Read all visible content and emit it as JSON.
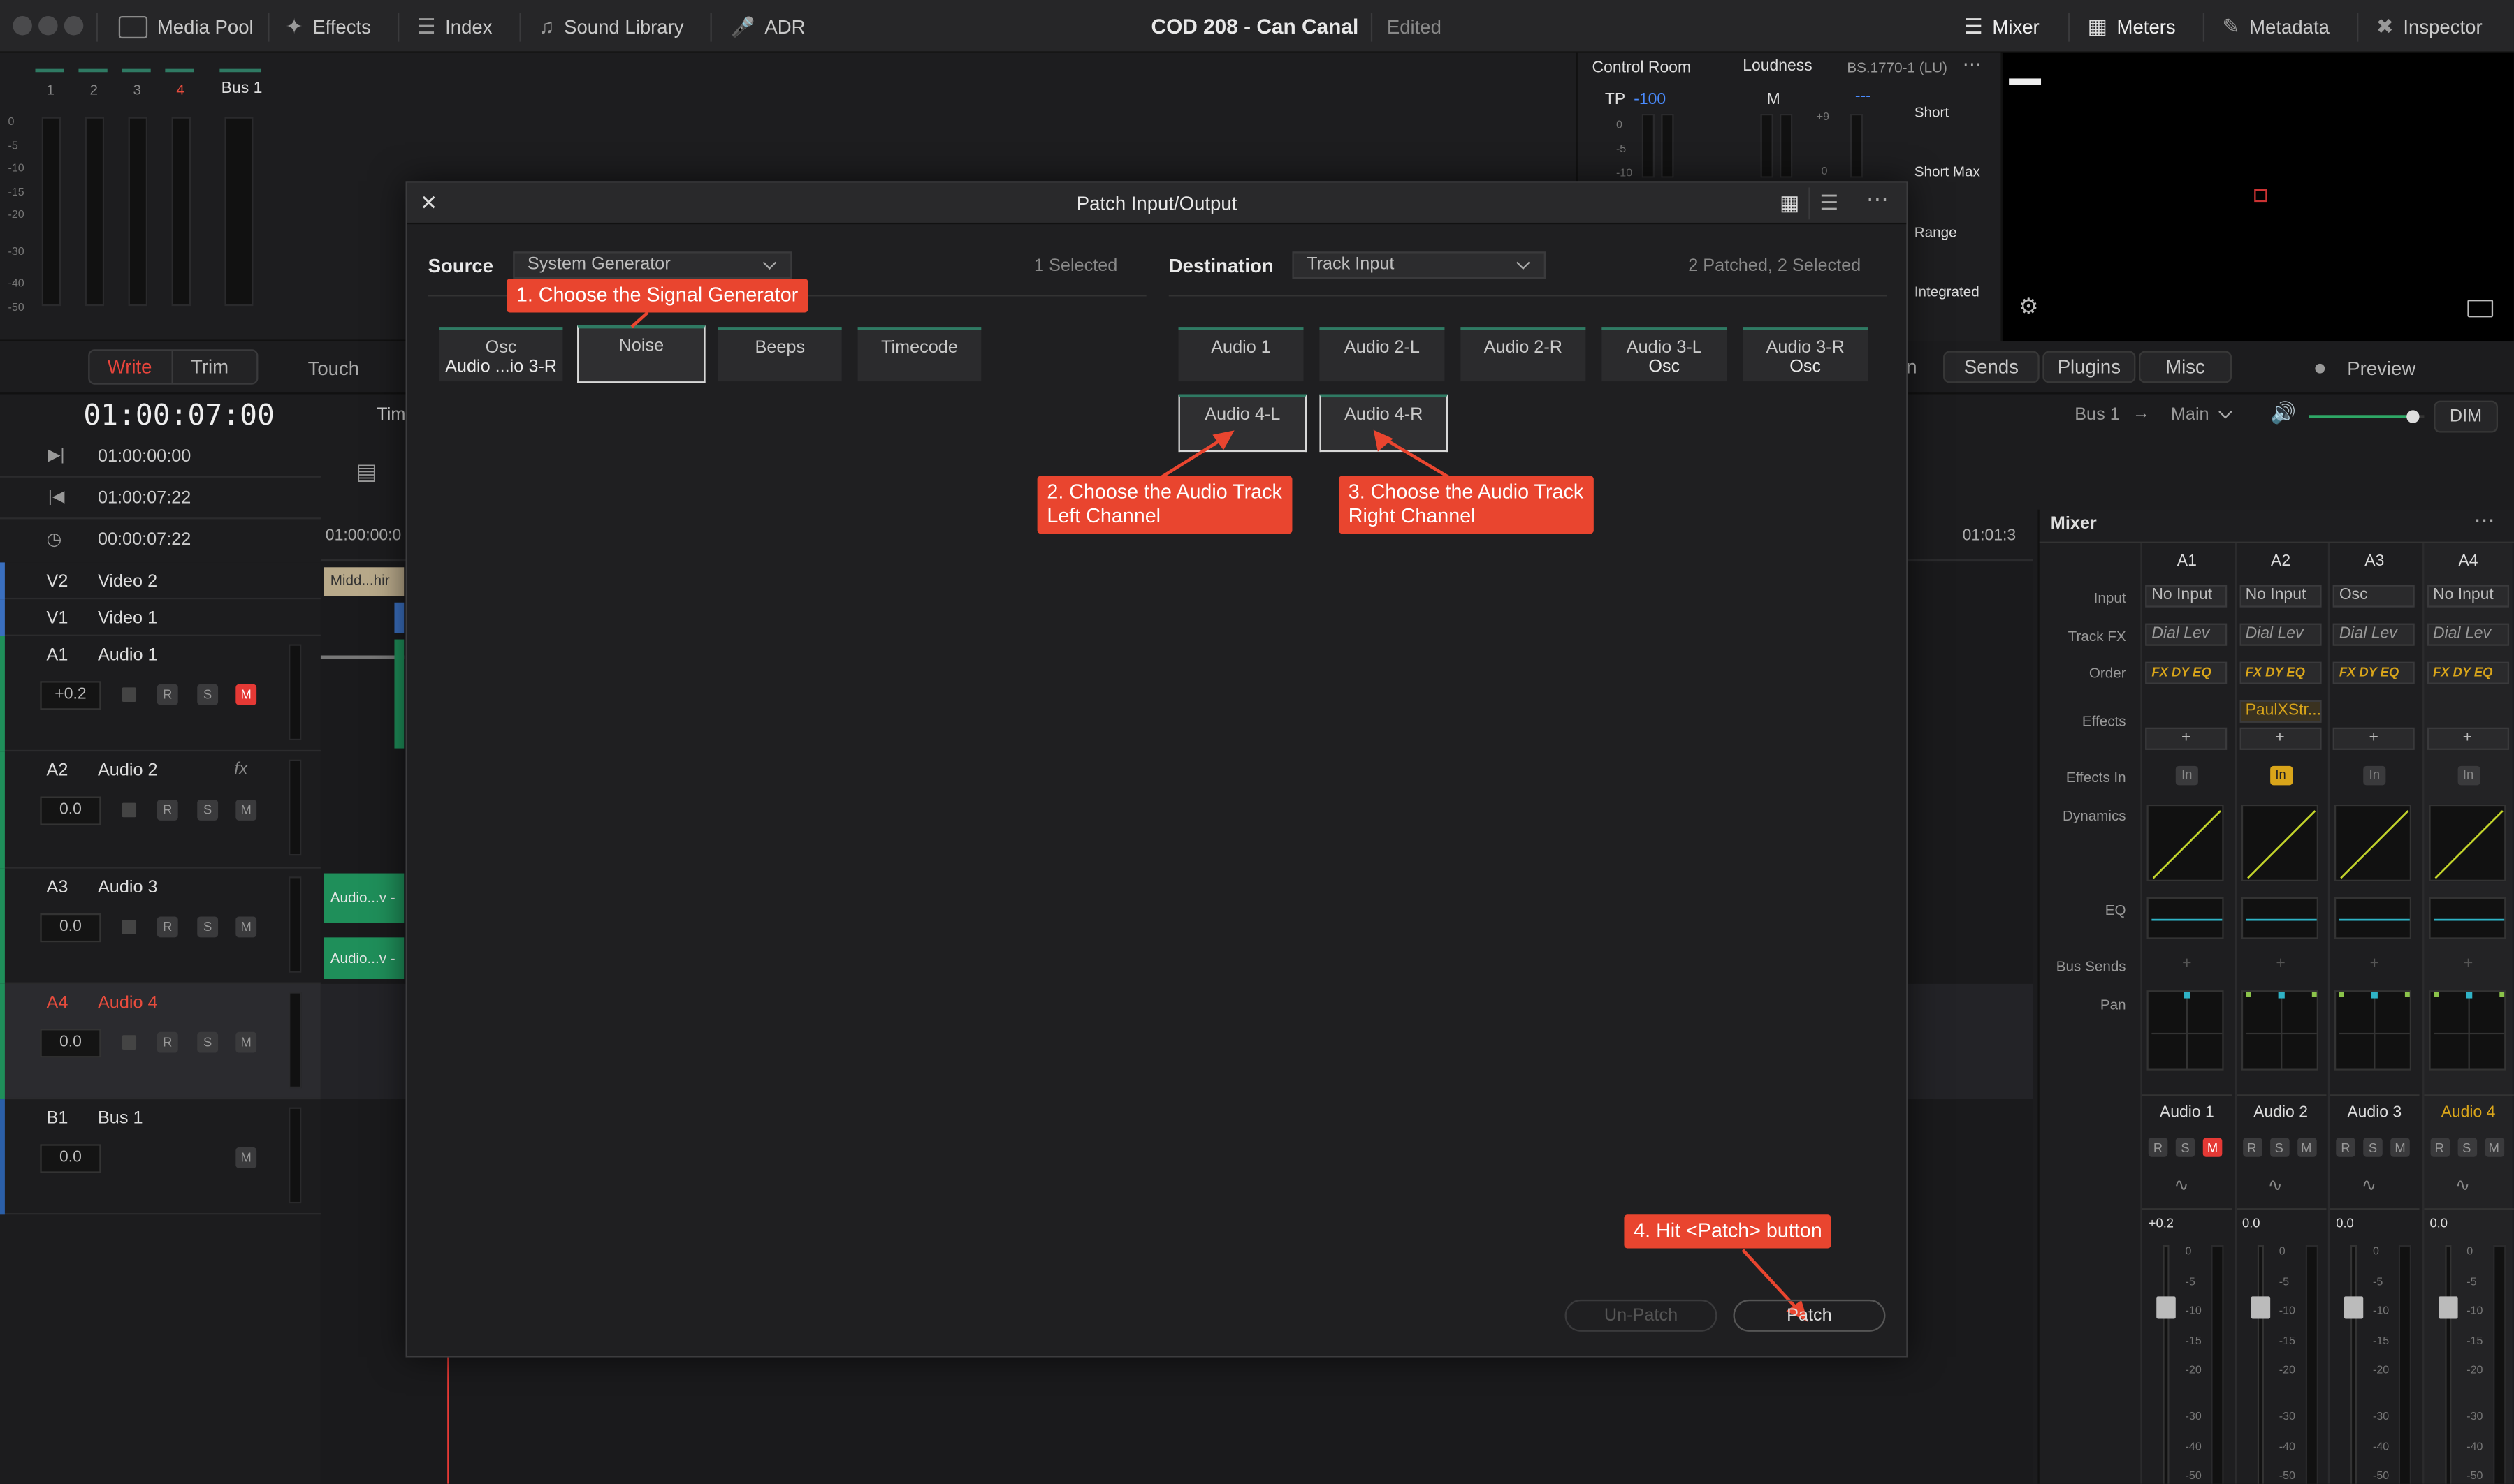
{
  "titlebar": {
    "left_buttons": [
      "Media Pool",
      "Effects",
      "Index",
      "Sound Library",
      "ADR"
    ],
    "project": "COD 208 - Can Canal",
    "status": "Edited",
    "right_buttons": [
      "Mixer",
      "Meters",
      "Metadata",
      "Inspector"
    ]
  },
  "meters": {
    "channels": [
      "1",
      "2",
      "3",
      "4"
    ],
    "bus": "Bus 1",
    "scale": [
      "0",
      "-5",
      "-10",
      "-15",
      "-20",
      "-30",
      "-40",
      "-50"
    ]
  },
  "control_room": {
    "title": "Control Room",
    "tp_label": "TP",
    "tp_value": "-100",
    "m_label": "M",
    "m_value": "---",
    "scale": [
      "0",
      "-5",
      "-10"
    ],
    "loudness_title": "Loudness",
    "loudness_std": "BS.1770-1 (LU)",
    "loud_scale_a": "+9",
    "loud_scale_b": "0",
    "stats": [
      "Short",
      "Short Max",
      "Range",
      "Integrated"
    ]
  },
  "edit_modes": {
    "write": "Write",
    "trim": "Trim",
    "touch": "Touch"
  },
  "timecode": {
    "main": "01:00:07:00",
    "in": "01:00:00:00",
    "out": "01:00:07:22",
    "duration": "00:00:07:22",
    "ruler_start": "01:00:00:0",
    "ruler_end": "01:01:3",
    "timeline_label": "Tim"
  },
  "tracks": [
    {
      "id": "V2",
      "name": "Video 2"
    },
    {
      "id": "V1",
      "name": "Video 1"
    },
    {
      "id": "A1",
      "name": "Audio 1",
      "vol": "+0.2"
    },
    {
      "id": "A2",
      "name": "Audio 2",
      "vol": "0.0",
      "fx": "fx"
    },
    {
      "id": "A3",
      "name": "Audio 3",
      "vol": "0.0"
    },
    {
      "id": "A4",
      "name": "Audio 4",
      "vol": "0.0"
    },
    {
      "id": "B1",
      "name": "Bus 1",
      "vol": "0.0"
    }
  ],
  "clips": {
    "v2": "Midd...hir",
    "a3a": "Audio...v -",
    "a3b": "Audio...v -"
  },
  "rsm": {
    "r": "R",
    "s": "S",
    "m": "M"
  },
  "dialog": {
    "title": "Patch Input/Output",
    "source_label": "Source",
    "source_value": "System Generator",
    "source_count": "1 Selected",
    "dest_label": "Destination",
    "dest_value": "Track Input",
    "dest_count": "2 Patched, 2 Selected",
    "sources": [
      {
        "l1": "Osc",
        "l2": "Audio ...io 3-R"
      },
      {
        "l1": "Noise",
        "l2": ""
      },
      {
        "l1": "Beeps",
        "l2": ""
      },
      {
        "l1": "Timecode",
        "l2": ""
      }
    ],
    "destinations": [
      {
        "l1": "Audio 1",
        "l2": ""
      },
      {
        "l1": "Audio 2-L",
        "l2": ""
      },
      {
        "l1": "Audio 2-R",
        "l2": ""
      },
      {
        "l1": "Audio 3-L",
        "l2": "Osc"
      },
      {
        "l1": "Audio 3-R",
        "l2": "Osc"
      },
      {
        "l1": "Audio 4-L",
        "l2": ""
      },
      {
        "l1": "Audio 4-R",
        "l2": ""
      }
    ],
    "unpatch": "Un-Patch",
    "patch": "Patch",
    "annotations": {
      "a1": "1. Choose the Signal Generator",
      "a2_l1": "2. Choose the Audio Track",
      "a2_l2": "Left Channel",
      "a3_l1": "3. Choose the Audio Track",
      "a3_l2": "Right Channel",
      "a4": "4. Hit <Patch> button"
    }
  },
  "right_tabs": {
    "sends": "Sends",
    "plugins": "Plugins",
    "misc": "Misc",
    "preview": "Preview",
    "partial": "n"
  },
  "monitor": {
    "bus": "Bus 1",
    "arrow": "→",
    "main": "Main",
    "dim": "DIM",
    "volume_level": 0.9
  },
  "mixer": {
    "title": "Mixer",
    "channels": [
      "A1",
      "A2",
      "A3",
      "A4"
    ],
    "row_labels": {
      "input": "Input",
      "trackfx": "Track FX",
      "order": "Order",
      "effects": "Effects",
      "effects_in": "Effects In",
      "dynamics": "Dynamics",
      "eq": "EQ",
      "bus_sends": "Bus Sends",
      "pan": "Pan"
    },
    "inputs": [
      "No Input",
      "No Input",
      "Osc",
      "No Input"
    ],
    "trackfx": [
      "Dial Lev",
      "Dial Lev",
      "Dial Lev",
      "Dial Lev"
    ],
    "order": "FX DY EQ",
    "effect_a2": "PaulXStr...",
    "plus": "+",
    "in": "In",
    "names": [
      "Audio 1",
      "Audio 2",
      "Audio 3",
      "Audio 4"
    ],
    "vols": [
      "+0.2",
      "0.0",
      "0.0",
      "0.0"
    ],
    "fader_scale": [
      "0",
      "-5",
      "-10",
      "-15",
      "-20",
      "-30",
      "-40",
      "-50"
    ],
    "colors": {
      "accent_yellow": "#d9a51a",
      "mute_red": "#e53935",
      "clip_green": "#1f8f5a",
      "eq_line": "#2fb3c6"
    }
  }
}
